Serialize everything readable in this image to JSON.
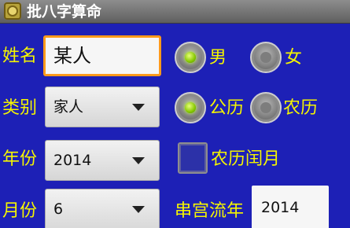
{
  "titlebar": {
    "icon": "app-icon",
    "title": "批八字算命"
  },
  "form": {
    "name_label": "姓名",
    "name_value": "某人",
    "gender_male": "男",
    "gender_female": "女",
    "gender_selected": "男",
    "type_label": "类别",
    "type_value": "家人",
    "calendar_solar": "公历",
    "calendar_lunar": "农历",
    "calendar_selected": "公历",
    "year_label": "年份",
    "year_value": "2014",
    "leap_month_label": "农历闰月",
    "leap_month_checked": false,
    "month_label": "月份",
    "month_value": "6",
    "flow_year_label": "串宫流年",
    "flow_year_value": "2014"
  },
  "colors": {
    "background": "#1d20b6",
    "label": "#f5f500",
    "focus_border": "#ff9a1a",
    "radio_checked": "#86c800"
  }
}
